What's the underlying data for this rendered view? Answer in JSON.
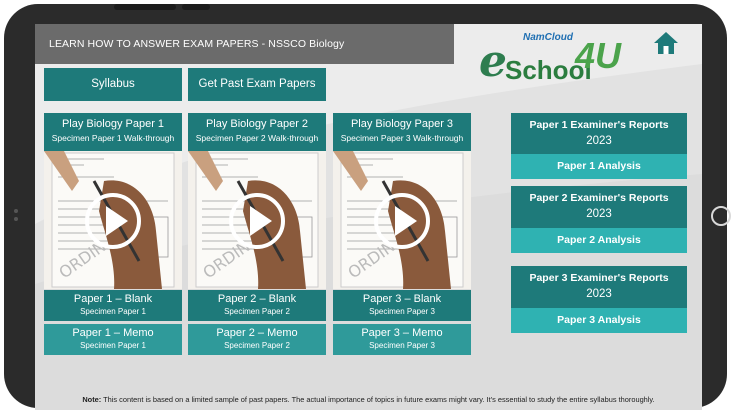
{
  "header": {
    "title_prefix": "LEARN HOW TO ANSWER EXAM PAPERS - NSSCO",
    "title_subject": "Biology"
  },
  "logo": {
    "cloud": "NamCloud",
    "e": "e",
    "school": "School",
    "suffix": "4U"
  },
  "nav": {
    "syllabus": "Syllabus",
    "past_papers": "Get Past Exam Papers"
  },
  "cards": [
    {
      "title": "Play Biology Paper 1",
      "subtitle": "Specimen Paper 1 Walk-through",
      "blank": "Paper 1 – Blank",
      "blank_sub": "Specimen Paper 1",
      "memo": "Paper 1 – Memo",
      "memo_sub": "Specimen Paper 1"
    },
    {
      "title": "Play Biology Paper 2",
      "subtitle": "Specimen Paper 2 Walk-through",
      "blank": "Paper 2 – Blank",
      "blank_sub": "Specimen Paper 2",
      "memo": "Paper 2 – Memo",
      "memo_sub": "Specimen Paper 2"
    },
    {
      "title": "Play Biology Paper 3",
      "subtitle": "Specimen Paper 3 Walk-through",
      "blank": "Paper 3 – Blank",
      "blank_sub": "Specimen Paper 3",
      "memo": "Paper 3 – Memo",
      "memo_sub": "Specimen Paper 3"
    }
  ],
  "reports": [
    {
      "title": "Paper 1 Examiner's Reports",
      "year": "2023",
      "analysis": "Paper 1 Analysis"
    },
    {
      "title": "Paper 2 Examiner's Reports",
      "year": "2023",
      "analysis": "Paper 2 Analysis"
    },
    {
      "title": "Paper 3 Examiner's Reports",
      "year": "2023",
      "analysis": "Paper 3 Analysis"
    }
  ],
  "note": {
    "label": "Note:",
    "text": "This content is based on a limited sample of past papers. The actual importance of topics in future exams might vary. It's essential to study the entire syllabus thoroughly."
  },
  "colors": {
    "teal_dark": "#1e7a7a",
    "teal": "#2f9a9a",
    "teal_light": "#2fb2b2",
    "header_gray": "#6b6b6b"
  }
}
